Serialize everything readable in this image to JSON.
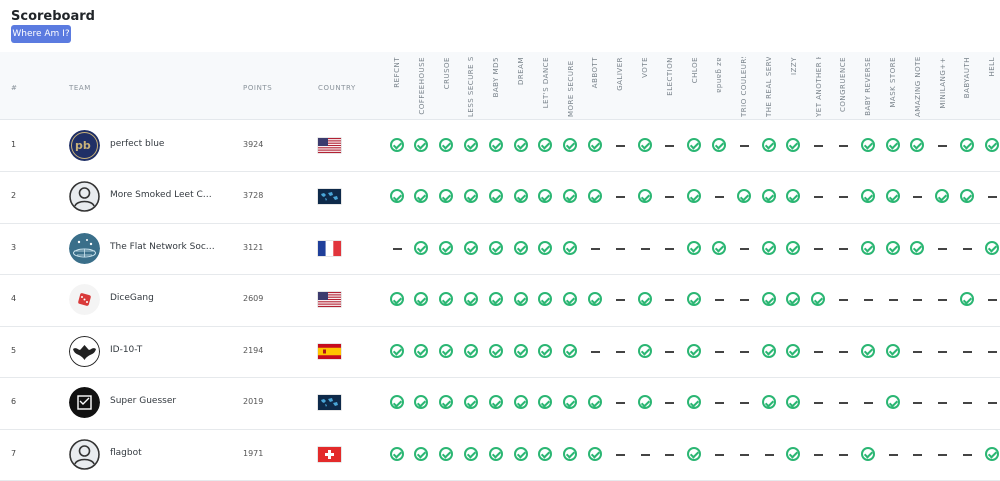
{
  "page": {
    "title": "Scoreboard",
    "where_button": "Where Am I?"
  },
  "table": {
    "headers": {
      "rank": "#",
      "team": "TEAM",
      "points": "POINTS",
      "country": "COUNTRY"
    },
    "challenges": [
      "REFCNT",
      "COFFEEHOUSE",
      "CRUSOE",
      "LESS SECURE SE",
      "BABY MD5",
      "DREAM",
      "LET'S DANCE",
      "MORE SECURE SE",
      "ABBOTT",
      "GALIVER",
      "VOTE",
      "ELECTION",
      "CHLOE",
      "ɐpuɐƃ zɐ",
      "TRIO COULEURS",
      "THE REAL SERVE",
      "IZZY",
      "YET ANOTHER H",
      "CONGRUENCE",
      "BABY REVERSE",
      "MASK STORE",
      "AMAZING NOTES",
      "MINILANG++",
      "BABYAUTH",
      "HELL"
    ],
    "rows": [
      {
        "rank": "1",
        "team": "perfect blue",
        "points": "3924",
        "country": "us",
        "avatar": "pb-logo-icon",
        "solves": [
          1,
          1,
          1,
          1,
          1,
          1,
          1,
          1,
          1,
          0,
          1,
          0,
          1,
          1,
          0,
          1,
          1,
          0,
          0,
          1,
          1,
          1,
          0,
          1,
          1
        ]
      },
      {
        "rank": "2",
        "team": "More Smoked Leet Ch...",
        "points": "3728",
        "country": "world",
        "avatar": "default-user-icon",
        "solves": [
          1,
          1,
          1,
          1,
          1,
          1,
          1,
          1,
          1,
          0,
          1,
          0,
          1,
          0,
          1,
          1,
          1,
          0,
          0,
          1,
          1,
          0,
          1,
          1,
          0
        ]
      },
      {
        "rank": "3",
        "team": "The Flat Network Soci...",
        "points": "3121",
        "country": "fr",
        "avatar": "flat-network-logo-icon",
        "solves": [
          0,
          1,
          1,
          1,
          1,
          1,
          1,
          1,
          0,
          0,
          0,
          0,
          1,
          1,
          0,
          1,
          1,
          0,
          0,
          1,
          1,
          1,
          0,
          0,
          1
        ]
      },
      {
        "rank": "4",
        "team": "DiceGang",
        "points": "2609",
        "country": "us",
        "avatar": "dice-logo-icon",
        "solves": [
          1,
          1,
          1,
          1,
          1,
          1,
          1,
          1,
          1,
          0,
          1,
          0,
          1,
          0,
          0,
          1,
          1,
          1,
          0,
          0,
          0,
          0,
          0,
          1,
          0
        ]
      },
      {
        "rank": "5",
        "team": "ID-10-T",
        "points": "2194",
        "country": "es",
        "avatar": "bat-logo-icon",
        "solves": [
          1,
          1,
          1,
          1,
          1,
          1,
          1,
          1,
          0,
          0,
          1,
          0,
          1,
          0,
          0,
          1,
          1,
          0,
          0,
          1,
          1,
          0,
          0,
          0,
          0
        ]
      },
      {
        "rank": "6",
        "team": "Super Guesser",
        "points": "2019",
        "country": "world",
        "avatar": "guesser-logo-icon",
        "solves": [
          1,
          1,
          1,
          1,
          1,
          1,
          1,
          1,
          1,
          0,
          1,
          0,
          1,
          0,
          0,
          1,
          1,
          0,
          0,
          0,
          1,
          0,
          0,
          0,
          0
        ]
      },
      {
        "rank": "7",
        "team": "flagbot",
        "points": "1971",
        "country": "ch",
        "avatar": "default-user-icon",
        "solves": [
          1,
          1,
          1,
          1,
          1,
          1,
          1,
          1,
          1,
          0,
          0,
          0,
          1,
          0,
          0,
          0,
          1,
          0,
          0,
          1,
          0,
          0,
          0,
          0,
          1
        ]
      }
    ]
  },
  "colors": {
    "solved": "#2bb673",
    "button": "#5b7be0",
    "header_bg": "#f7f9fb"
  }
}
